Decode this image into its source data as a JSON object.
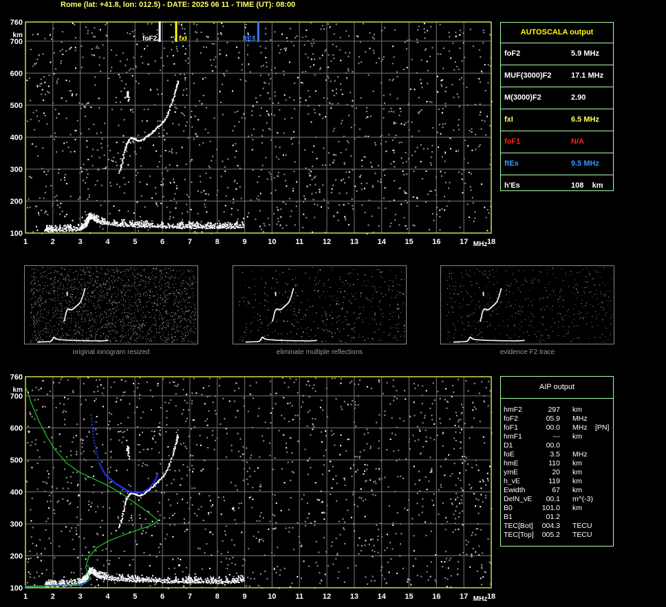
{
  "header": {
    "text": "Rome (lat: +41.8, lon: 012.5) - DATE: 2025 06 11 - TIME (UT): 08:00"
  },
  "colors": {
    "frame": "#d8d84a",
    "grid": "#777777",
    "fof2": "#ffffff",
    "fxi": "#ffff00",
    "ftes": "#3377ff",
    "fof1": "#ff2020",
    "profile": "#22cc22",
    "trace": "#2233ff",
    "panel_border": "#aaffaa"
  },
  "autoscala": {
    "title": "AUTOSCALA output",
    "rows": [
      {
        "key": "foF2",
        "value": "5.9 MHz",
        "color": "#ffffff"
      },
      {
        "key": "MUF(3000)F2",
        "value": "17.1 MHz",
        "color": "#ffffff"
      },
      {
        "key": "M(3000)F2",
        "value": "2.90",
        "color": "#ffffff"
      },
      {
        "key": "fxI",
        "value": "6.5 MHz",
        "color": "#ffff66"
      },
      {
        "key": "foF1",
        "value": "N/A",
        "color": "#ff2020"
      },
      {
        "key": "ftEs",
        "value": "9.5 MHz",
        "color": "#3399ff"
      },
      {
        "key": "h'Es",
        "value": "108    km",
        "color": "#ffffff"
      }
    ]
  },
  "aip": {
    "title": "AIP output",
    "rows": [
      {
        "key": "hmF2",
        "value": "297",
        "unit": "km",
        "extra": ""
      },
      {
        "key": "foF2",
        "value": "05.9",
        "unit": "MHz",
        "extra": ""
      },
      {
        "key": "foF1",
        "value": "00.0",
        "unit": "MHz",
        "extra": "[PN]"
      },
      {
        "key": "hmF1",
        "value": "---",
        "unit": "km",
        "extra": ""
      },
      {
        "key": "D1",
        "value": "00.0",
        "unit": "",
        "extra": ""
      },
      {
        "key": "foE",
        "value": "3.5",
        "unit": "MHz",
        "extra": ""
      },
      {
        "key": "hmE",
        "value": "110",
        "unit": "km",
        "extra": ""
      },
      {
        "key": "ymE",
        "value": "20",
        "unit": "km",
        "extra": ""
      },
      {
        "key": "h_vE",
        "value": "119",
        "unit": "km",
        "extra": ""
      },
      {
        "key": "Ewidth",
        "value": "67",
        "unit": "km",
        "extra": ""
      },
      {
        "key": "DelN_vE",
        "value": "00.1",
        "unit": "m^(-3)",
        "extra": ""
      },
      {
        "key": "B0",
        "value": "101.0",
        "unit": "km",
        "extra": ""
      },
      {
        "key": "B1",
        "value": "01.2",
        "unit": "",
        "extra": ""
      },
      {
        "key": "TEC[Bot]",
        "value": "004.3",
        "unit": "TECU",
        "extra": ""
      },
      {
        "key": "TEC[Top]",
        "value": "005.2",
        "unit": "TECU",
        "extra": ""
      }
    ]
  },
  "thumbnails": [
    {
      "caption": "original ionogram resized"
    },
    {
      "caption": "eliminate multiple reflections"
    },
    {
      "caption": "evidence F2 trace"
    }
  ],
  "chart_data": [
    {
      "type": "scatter",
      "name_hint": "ionogram-top",
      "xlim": [
        1,
        18
      ],
      "ylim": [
        100,
        760
      ],
      "x_ticks": [
        "1",
        "2",
        "3",
        "4",
        "5",
        "6",
        "7",
        "8",
        "9",
        "10",
        "11",
        "12",
        "13",
        "14",
        "15",
        "16",
        "17",
        "18"
      ],
      "y_ticks": [
        "100",
        "200",
        "300",
        "400",
        "500",
        "600",
        "700",
        "760"
      ],
      "xunit": "MHz",
      "yunit": "km",
      "grid": true,
      "markers": [
        {
          "label": "foF2",
          "x": 5.9,
          "color": "#ffffff"
        },
        {
          "label": "fxI",
          "x": 6.5,
          "color": "#ffff00"
        },
        {
          "label": "ftEs",
          "x": 9.5,
          "color": "#3377ff"
        }
      ],
      "traces": [
        {
          "name": "Es",
          "points": [
            [
              1.7,
              107
            ],
            [
              2.0,
              108
            ],
            [
              2.5,
              109
            ],
            [
              3.0,
              112
            ],
            [
              3.2,
              125
            ],
            [
              3.3,
              145
            ],
            [
              3.4,
              150
            ],
            [
              3.6,
              135
            ],
            [
              4.0,
              128
            ],
            [
              4.5,
              125
            ],
            [
              5.0,
              122
            ],
            [
              5.5,
              121
            ],
            [
              6.0,
              120
            ],
            [
              6.5,
              119
            ],
            [
              7.0,
              118
            ],
            [
              7.5,
              118
            ],
            [
              8.0,
              117
            ],
            [
              8.5,
              118
            ],
            [
              9.0,
              122
            ]
          ]
        },
        {
          "name": "F2",
          "points": [
            [
              4.4,
              290
            ],
            [
              4.5,
              320
            ],
            [
              4.6,
              360
            ],
            [
              4.7,
              385
            ],
            [
              4.85,
              400
            ],
            [
              5.0,
              395
            ],
            [
              5.1,
              390
            ],
            [
              5.3,
              395
            ],
            [
              5.5,
              410
            ],
            [
              5.7,
              425
            ],
            [
              5.9,
              440
            ],
            [
              6.1,
              460
            ],
            [
              6.25,
              490
            ],
            [
              6.4,
              530
            ],
            [
              6.5,
              560
            ],
            [
              6.55,
              580
            ]
          ]
        },
        {
          "name": "F2x",
          "points": [
            [
              4.7,
              530
            ],
            [
              4.72,
              545
            ],
            [
              4.75,
              510
            ]
          ]
        }
      ]
    },
    {
      "type": "scatter",
      "name_hint": "ionogram-bottom",
      "xlim": [
        1,
        18
      ],
      "ylim": [
        100,
        760
      ],
      "x_ticks": [
        "1",
        "2",
        "3",
        "4",
        "5",
        "6",
        "7",
        "8",
        "9",
        "10",
        "11",
        "12",
        "13",
        "14",
        "15",
        "16",
        "17",
        "18"
      ],
      "y_ticks": [
        "100",
        "200",
        "300",
        "400",
        "500",
        "600",
        "700",
        "760"
      ],
      "xunit": "MHz",
      "yunit": "km",
      "grid": true,
      "traces": [
        {
          "name": "Es",
          "points": [
            [
              1.7,
              107
            ],
            [
              2.0,
              108
            ],
            [
              2.5,
              109
            ],
            [
              3.0,
              112
            ],
            [
              3.2,
              125
            ],
            [
              3.3,
              145
            ],
            [
              3.4,
              150
            ],
            [
              3.6,
              135
            ],
            [
              4.0,
              128
            ],
            [
              4.5,
              125
            ],
            [
              5.0,
              122
            ],
            [
              5.5,
              121
            ],
            [
              6.0,
              120
            ],
            [
              6.5,
              119
            ],
            [
              7.0,
              118
            ],
            [
              7.5,
              118
            ],
            [
              8.0,
              117
            ],
            [
              8.5,
              118
            ],
            [
              9.0,
              122
            ]
          ]
        },
        {
          "name": "F2",
          "points": [
            [
              4.4,
              290
            ],
            [
              4.5,
              320
            ],
            [
              4.6,
              360
            ],
            [
              4.7,
              385
            ],
            [
              4.85,
              400
            ],
            [
              5.0,
              395
            ],
            [
              5.1,
              390
            ],
            [
              5.3,
              395
            ],
            [
              5.5,
              410
            ],
            [
              5.7,
              425
            ],
            [
              5.9,
              440
            ],
            [
              6.1,
              460
            ],
            [
              6.25,
              490
            ],
            [
              6.4,
              530
            ],
            [
              6.5,
              560
            ],
            [
              6.55,
              580
            ]
          ]
        },
        {
          "name": "F2x",
          "points": [
            [
              4.7,
              530
            ],
            [
              4.72,
              545
            ],
            [
              4.75,
              510
            ]
          ]
        }
      ],
      "profile": [
        [
          1.0,
          730
        ],
        [
          1.2,
          680
        ],
        [
          1.5,
          620
        ],
        [
          1.8,
          570
        ],
        [
          2.1,
          530
        ],
        [
          2.5,
          490
        ],
        [
          3.0,
          460
        ],
        [
          3.5,
          440
        ],
        [
          4.0,
          420
        ],
        [
          4.5,
          395
        ],
        [
          5.0,
          365
        ],
        [
          5.5,
          335
        ],
        [
          5.85,
          310
        ],
        [
          5.6,
          295
        ],
        [
          5.0,
          278
        ],
        [
          4.5,
          262
        ],
        [
          4.0,
          245
        ],
        [
          3.6,
          225
        ],
        [
          3.3,
          195
        ],
        [
          3.2,
          165
        ],
        [
          3.3,
          140
        ],
        [
          3.4,
          128
        ],
        [
          3.2,
          118
        ],
        [
          3.0,
          112
        ],
        [
          2.5,
          108
        ],
        [
          2.0,
          105
        ],
        [
          1.5,
          104
        ],
        [
          1.0,
          103
        ]
      ],
      "fitted_trace": [
        [
          1.0,
          105
        ],
        [
          1.5,
          106
        ],
        [
          2.0,
          107
        ],
        [
          2.5,
          108
        ],
        [
          3.0,
          110
        ],
        [
          3.2,
          115
        ],
        [
          3.3,
          125
        ],
        [
          3.4,
          640
        ],
        [
          3.5,
          560
        ],
        [
          3.7,
          490
        ],
        [
          3.9,
          455
        ],
        [
          4.1,
          440
        ],
        [
          4.3,
          425
        ],
        [
          4.5,
          415
        ],
        [
          4.7,
          405
        ],
        [
          4.9,
          398
        ],
        [
          5.1,
          397
        ],
        [
          5.3,
          400
        ],
        [
          5.5,
          410
        ],
        [
          5.7,
          430
        ],
        [
          5.85,
          460
        ]
      ]
    }
  ]
}
